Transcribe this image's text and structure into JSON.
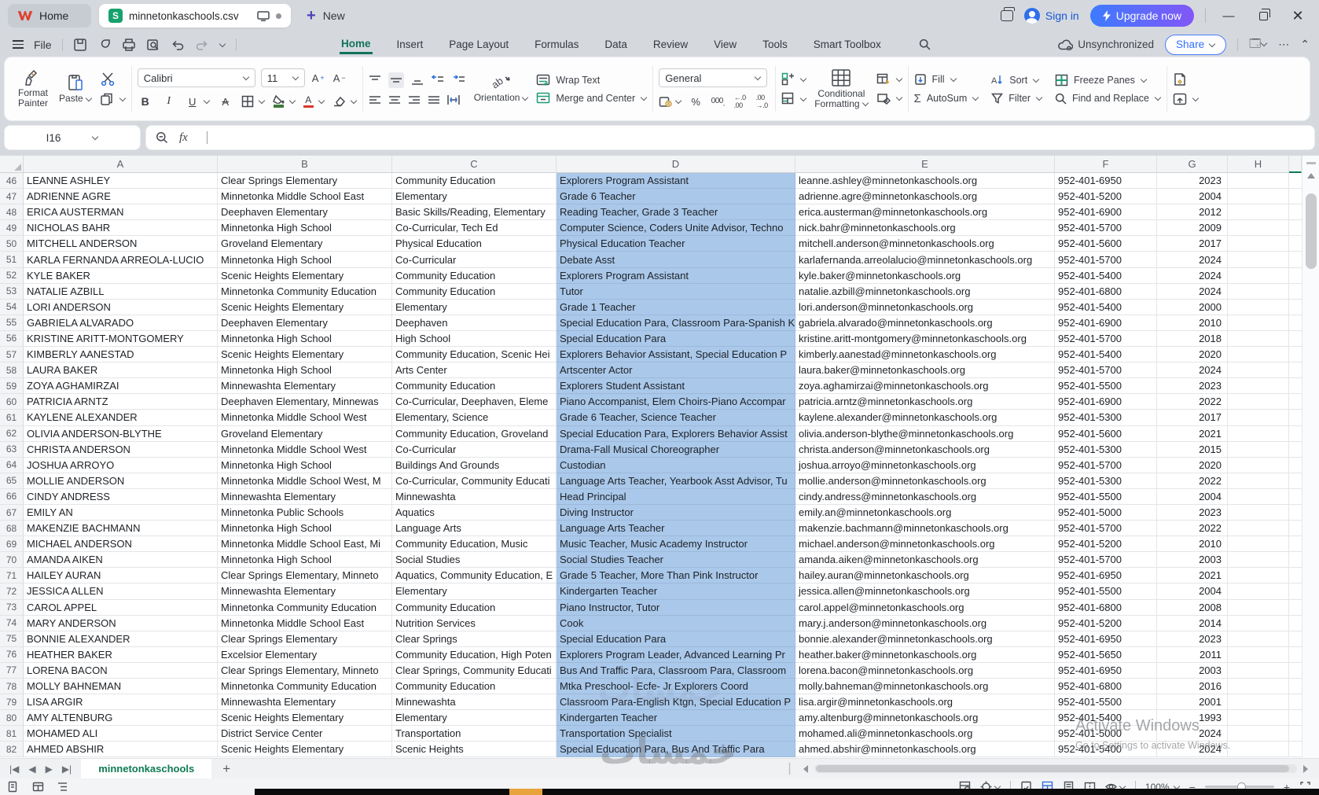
{
  "window": {
    "home_label": "Home",
    "doc_title": "minnetonkaschools.csv",
    "new_label": "New",
    "sign_in": "Sign in",
    "upgrade": "Upgrade now"
  },
  "menu": {
    "file": "File",
    "tabs": [
      "Home",
      "Insert",
      "Page Layout",
      "Formulas",
      "Data",
      "Review",
      "View",
      "Tools",
      "Smart Toolbox"
    ],
    "active_tab": "Home",
    "unsynchronized": "Unsynchronized",
    "share": "Share"
  },
  "ribbon": {
    "format_painter_1": "Format",
    "format_painter_2": "Painter",
    "paste": "Paste",
    "font_name": "Calibri",
    "font_size": "11",
    "orientation": "Orientation",
    "wrap_text": "Wrap Text",
    "merge_center": "Merge and Center",
    "number_format": "General",
    "percent": "%",
    "thousands": "000",
    "cond_fmt_1": "Conditional",
    "cond_fmt_2": "Formatting",
    "fill": "Fill",
    "autosum": "AutoSum",
    "sort": "Sort",
    "filter": "Filter",
    "freeze_panes": "Freeze Panes",
    "find_replace": "Find and Replace"
  },
  "formula_bar": {
    "name_box": "I16",
    "fx": "fx",
    "formula": ""
  },
  "grid": {
    "columns": [
      "A",
      "B",
      "C",
      "D",
      "E",
      "F",
      "G",
      "H"
    ],
    "selected_column": "D",
    "active_cell": "I16",
    "rows": [
      {
        "n": 46,
        "cells": [
          "LEANNE ASHLEY",
          "Clear Springs Elementary",
          "Community Education",
          "Explorers Program Assistant",
          "leanne.ashley@minnetonkaschools.org",
          "952-401-6950",
          "2023"
        ]
      },
      {
        "n": 47,
        "cells": [
          "ADRIENNE AGRE",
          "Minnetonka Middle School East",
          "Elementary",
          "Grade 6 Teacher",
          "adrienne.agre@minnetonkaschools.org",
          "952-401-5200",
          "2004"
        ]
      },
      {
        "n": 48,
        "cells": [
          "ERICA AUSTERMAN",
          "Deephaven Elementary",
          "Basic Skills/Reading, Elementary",
          "Reading Teacher, Grade 3 Teacher",
          "erica.austerman@minnetonkaschools.org",
          "952-401-6900",
          "2012"
        ]
      },
      {
        "n": 49,
        "cells": [
          "NICHOLAS BAHR",
          "Minnetonka High School",
          "Co-Curricular, Tech Ed",
          "Computer Science, Coders Unite Advisor, Techno",
          "nick.bahr@minnetonkaschools.org",
          "952-401-5700",
          "2009"
        ]
      },
      {
        "n": 50,
        "cells": [
          "MITCHELL ANDERSON",
          "Groveland Elementary",
          "Physical Education",
          "Physical Education Teacher",
          "mitchell.anderson@minnetonkaschools.org",
          "952-401-5600",
          "2017"
        ]
      },
      {
        "n": 51,
        "cells": [
          "KARLA FERNANDA ARREOLA-LUCIO",
          "Minnetonka High School",
          "Co-Curricular",
          "Debate Asst",
          "karlafernanda.arreolalucio@minnetonkaschools.org",
          "952-401-5700",
          "2024"
        ]
      },
      {
        "n": 52,
        "cells": [
          "KYLE BAKER",
          "Scenic Heights Elementary",
          "Community Education",
          "Explorers Program Assistant",
          "kyle.baker@minnetonkaschools.org",
          "952-401-5400",
          "2024"
        ]
      },
      {
        "n": 53,
        "cells": [
          "NATALIE AZBILL",
          "Minnetonka Community Education",
          "Community Education",
          "Tutor",
          "natalie.azbill@minnetonkaschools.org",
          "952-401-6800",
          "2024"
        ]
      },
      {
        "n": 54,
        "cells": [
          "LORI ANDERSON",
          "Scenic Heights Elementary",
          "Elementary",
          "Grade 1 Teacher",
          "lori.anderson@minnetonkaschools.org",
          "952-401-5400",
          "2000"
        ]
      },
      {
        "n": 55,
        "cells": [
          "GABRIELA ALVARADO",
          "Deephaven Elementary",
          "Deephaven",
          "Special Education Para, Classroom Para-Spanish K",
          "gabriela.alvarado@minnetonkaschools.org",
          "952-401-6900",
          "2010"
        ]
      },
      {
        "n": 56,
        "cells": [
          "KRISTINE ARITT-MONTGOMERY",
          "Minnetonka High School",
          "High School",
          "Special Education Para",
          "kristine.aritt-montgomery@minnetonkaschools.org",
          "952-401-5700",
          "2018"
        ]
      },
      {
        "n": 57,
        "cells": [
          "KIMBERLY AANESTAD",
          "Scenic Heights Elementary",
          "Community Education, Scenic Hei",
          "Explorers Behavior Assistant, Special Education P",
          "kimberly.aanestad@minnetonkaschools.org",
          "952-401-5400",
          "2020"
        ]
      },
      {
        "n": 58,
        "cells": [
          "LAURA BAKER",
          "Minnetonka High School",
          "Arts Center",
          "Artscenter Actor",
          "laura.baker@minnetonkaschools.org",
          "952-401-5700",
          "2024"
        ]
      },
      {
        "n": 59,
        "cells": [
          "ZOYA AGHAMIRZAI",
          "Minnewashta Elementary",
          "Community Education",
          "Explorers Student Assistant",
          "zoya.aghamirzai@minnetonkaschools.org",
          "952-401-5500",
          "2023"
        ]
      },
      {
        "n": 60,
        "cells": [
          "PATRICIA ARNTZ",
          "Deephaven Elementary, Minnewas",
          "Co-Curricular, Deephaven, Eleme",
          "Piano Accompanist, Elem Choirs-Piano Accompar",
          "patricia.arntz@minnetonkaschools.org",
          "952-401-6900",
          "2022"
        ]
      },
      {
        "n": 61,
        "cells": [
          "KAYLENE ALEXANDER",
          "Minnetonka Middle School West",
          "Elementary, Science",
          "Grade 6 Teacher, Science Teacher",
          "kaylene.alexander@minnetonkaschools.org",
          "952-401-5300",
          "2017"
        ]
      },
      {
        "n": 62,
        "cells": [
          "OLIVIA ANDERSON-BLYTHE",
          "Groveland Elementary",
          "Community Education, Groveland",
          "Special Education Para, Explorers Behavior Assist",
          "olivia.anderson-blythe@minnetonkaschools.org",
          "952-401-5600",
          "2021"
        ]
      },
      {
        "n": 63,
        "cells": [
          "CHRISTA ANDERSON",
          "Minnetonka Middle School West",
          "Co-Curricular",
          "Drama-Fall Musical Choreographer",
          "christa.anderson@minnetonkaschools.org",
          "952-401-5300",
          "2015"
        ]
      },
      {
        "n": 64,
        "cells": [
          "JOSHUA ARROYO",
          "Minnetonka High School",
          "Buildings And Grounds",
          "Custodian",
          "joshua.arroyo@minnetonkaschools.org",
          "952-401-5700",
          "2020"
        ]
      },
      {
        "n": 65,
        "cells": [
          "MOLLIE ANDERSON",
          "Minnetonka Middle School West, M",
          "Co-Curricular, Community Educati",
          "Language Arts Teacher, Yearbook Asst Advisor, Tu",
          "mollie.anderson@minnetonkaschools.org",
          "952-401-5300",
          "2022"
        ]
      },
      {
        "n": 66,
        "cells": [
          "CINDY ANDRESS",
          "Minnewashta Elementary",
          "Minnewashta",
          "Head Principal",
          "cindy.andress@minnetonkaschools.org",
          "952-401-5500",
          "2004"
        ]
      },
      {
        "n": 67,
        "cells": [
          "EMILY AN",
          "Minnetonka Public Schools",
          "Aquatics",
          "Diving Instructor",
          "emily.an@minnetonkaschools.org",
          "952-401-5000",
          "2023"
        ]
      },
      {
        "n": 68,
        "cells": [
          "MAKENZIE BACHMANN",
          "Minnetonka High School",
          "Language Arts",
          "Language Arts Teacher",
          "makenzie.bachmann@minnetonkaschools.org",
          "952-401-5700",
          "2022"
        ]
      },
      {
        "n": 69,
        "cells": [
          "MICHAEL ANDERSON",
          "Minnetonka Middle School East, Mi",
          "Community Education, Music",
          "Music Teacher, Music Academy Instructor",
          "michael.anderson@minnetonkaschools.org",
          "952-401-5200",
          "2010"
        ]
      },
      {
        "n": 70,
        "cells": [
          "AMANDA AIKEN",
          "Minnetonka High School",
          "Social Studies",
          "Social Studies Teacher",
          "amanda.aiken@minnetonkaschools.org",
          "952-401-5700",
          "2003"
        ]
      },
      {
        "n": 71,
        "cells": [
          "HAILEY AURAN",
          "Clear Springs Elementary, Minneto",
          "Aquatics, Community Education, E",
          "Grade 5 Teacher, More Than Pink Instructor",
          "hailey.auran@minnetonkaschools.org",
          "952-401-6950",
          "2021"
        ]
      },
      {
        "n": 72,
        "cells": [
          "JESSICA ALLEN",
          "Minnewashta Elementary",
          "Elementary",
          "Kindergarten Teacher",
          "jessica.allen@minnetonkaschools.org",
          "952-401-5500",
          "2004"
        ]
      },
      {
        "n": 73,
        "cells": [
          "CAROL APPEL",
          "Minnetonka Community Education",
          "Community Education",
          "Piano Instructor, Tutor",
          "carol.appel@minnetonkaschools.org",
          "952-401-6800",
          "2008"
        ]
      },
      {
        "n": 74,
        "cells": [
          "MARY ANDERSON",
          "Minnetonka Middle School East",
          "Nutrition Services",
          "Cook",
          "mary.j.anderson@minnetonkaschools.org",
          "952-401-5200",
          "2014"
        ]
      },
      {
        "n": 75,
        "cells": [
          "BONNIE ALEXANDER",
          "Clear Springs Elementary",
          "Clear Springs",
          "Special Education Para",
          "bonnie.alexander@minnetonkaschools.org",
          "952-401-6950",
          "2023"
        ]
      },
      {
        "n": 76,
        "cells": [
          "HEATHER BAKER",
          "Excelsior Elementary",
          "Community Education, High Poten",
          "Explorers Program Leader, Advanced Learning Pr",
          "heather.baker@minnetonkaschools.org",
          "952-401-5650",
          "2011"
        ]
      },
      {
        "n": 77,
        "cells": [
          "LORENA BACON",
          "Clear Springs Elementary, Minneto",
          "Clear Springs, Community Educati",
          "Bus And Traffic Para, Classroom Para, Classroom",
          "lorena.bacon@minnetonkaschools.org",
          "952-401-6950",
          "2003"
        ]
      },
      {
        "n": 78,
        "cells": [
          "MOLLY BAHNEMAN",
          "Minnetonka Community Education",
          "Community Education",
          "Mtka Preschool- Ecfe- Jr Explorers Coord",
          "molly.bahneman@minnetonkaschools.org",
          "952-401-6800",
          "2016"
        ]
      },
      {
        "n": 79,
        "cells": [
          "LISA ARGIR",
          "Minnewashta Elementary",
          "Minnewashta",
          "Classroom Para-English Ktgn, Special Education P",
          "lisa.argir@minnetonkaschools.org",
          "952-401-5500",
          "2001"
        ]
      },
      {
        "n": 80,
        "cells": [
          "AMY ALTENBURG",
          "Scenic Heights Elementary",
          "Elementary",
          "Kindergarten Teacher",
          "amy.altenburg@minnetonkaschools.org",
          "952-401-5400",
          "1993"
        ]
      },
      {
        "n": 81,
        "cells": [
          "MOHAMED ALI",
          "District Service Center",
          "Transportation",
          "Transportation Specialist",
          "mohamed.ali@minnetonkaschools.org",
          "952-401-5000",
          "2024"
        ]
      },
      {
        "n": 82,
        "cells": [
          "AHMED ABSHIR",
          "Scenic Heights Elementary",
          "Scenic Heights",
          "Special Education Para, Bus And Traffic Para",
          "ahmed.abshir@minnetonkaschools.org",
          "952-401-5400",
          "2024"
        ]
      }
    ]
  },
  "sheet_bar": {
    "active_tab": "minnetonkaschools"
  },
  "status_bar": {
    "zoom": "100%"
  },
  "watermarks": {
    "brand": "خمسات",
    "activate_line1": "Activate Windows",
    "activate_line2": "Go to Settings to activate Windows."
  }
}
